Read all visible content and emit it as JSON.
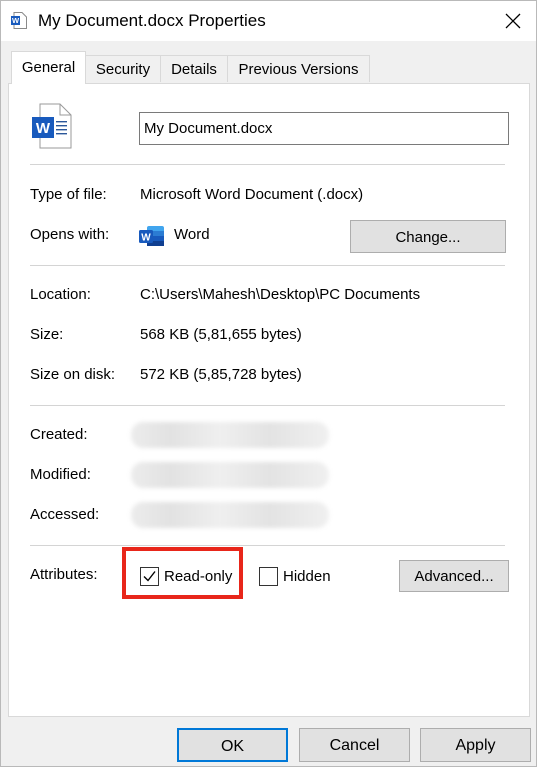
{
  "window": {
    "title": "My Document.docx Properties",
    "close_glyph": "✕"
  },
  "tabs": [
    {
      "label": "General",
      "active": true
    },
    {
      "label": "Security",
      "active": false
    },
    {
      "label": "Details",
      "active": false
    },
    {
      "label": "Previous Versions",
      "active": false
    }
  ],
  "general": {
    "file_name": "My Document.docx",
    "type_of_file": {
      "label": "Type of file:",
      "value": "Microsoft Word Document (.docx)"
    },
    "opens_with": {
      "label": "Opens with:",
      "value": "Word",
      "change_button": "Change..."
    },
    "location": {
      "label": "Location:",
      "value": "C:\\Users\\Mahesh\\Desktop\\PC Documents"
    },
    "size": {
      "label": "Size:",
      "value": "568 KB (5,81,655 bytes)"
    },
    "size_on_disk": {
      "label": "Size on disk:",
      "value": "572 KB (5,85,728 bytes)"
    },
    "created": {
      "label": "Created:"
    },
    "modified": {
      "label": "Modified:"
    },
    "accessed": {
      "label": "Accessed:"
    },
    "attributes": {
      "label": "Attributes:",
      "read_only": {
        "label": "Read-only",
        "checked": true
      },
      "hidden": {
        "label": "Hidden",
        "checked": false
      },
      "advanced_button": "Advanced..."
    }
  },
  "footer": {
    "ok": "OK",
    "cancel": "Cancel",
    "apply": "Apply"
  },
  "colors": {
    "word_blue": "#185abd",
    "highlight_red": "#e8261a",
    "ok_border": "#0078d7"
  },
  "icons": [
    "word-document-icon",
    "word-app-icon",
    "close-icon",
    "checkmark-icon"
  ]
}
